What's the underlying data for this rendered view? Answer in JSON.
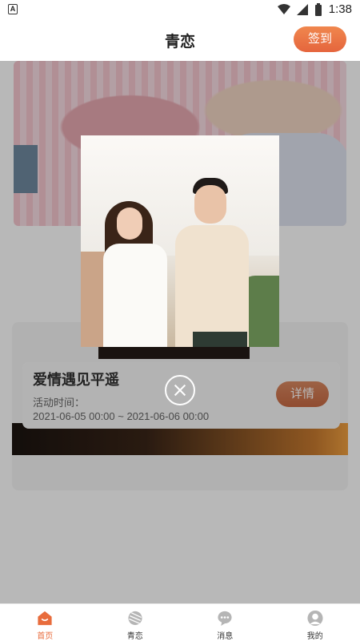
{
  "status_bar": {
    "time": "1:38",
    "notification_icon": "A"
  },
  "header": {
    "title": "青恋",
    "checkin_label": "签到"
  },
  "activity": {
    "title": "爱情遇见平遥",
    "time_label": "活动时间：",
    "time_range": "2021-06-05 00:00 ~ 2021-06-06 00:00",
    "details_label": "详情"
  },
  "tabs": [
    {
      "label": "首页",
      "icon": "home-icon",
      "active": true
    },
    {
      "label": "青恋",
      "icon": "yarn-icon",
      "active": false
    },
    {
      "label": "消息",
      "icon": "chat-icon",
      "active": false
    },
    {
      "label": "我的",
      "icon": "profile-icon",
      "active": false
    }
  ],
  "colors": {
    "accent": "#e86c3c",
    "tab_inactive": "#b5b5b5"
  }
}
